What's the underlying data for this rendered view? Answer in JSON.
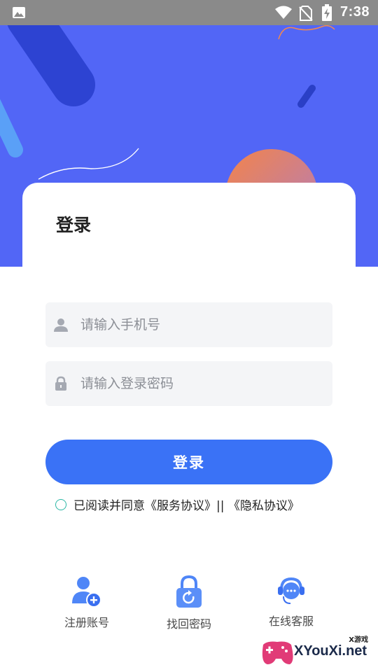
{
  "status_bar": {
    "time": "7:38",
    "icons": [
      "gallery-icon",
      "wifi-icon",
      "no-sim-icon",
      "battery-charging-icon"
    ]
  },
  "login": {
    "title": "登录",
    "phone_placeholder": "请输入手机号",
    "password_placeholder": "请输入登录密码",
    "submit_label": "登录",
    "agreement_text": "已阅读并同意《服务协议》|| 《隐私协议》"
  },
  "actions": [
    {
      "label": "注册账号",
      "icon": "add-user-icon"
    },
    {
      "label": "找回密码",
      "icon": "lock-refresh-icon"
    },
    {
      "label": "在线客服",
      "icon": "customer-service-icon"
    }
  ],
  "watermark": {
    "small_text": "X游戏",
    "brand_text": "XYouXi.net"
  },
  "colors": {
    "header_blue": "#4f65f6",
    "button_blue": "#3a72f6",
    "radio_teal": "#2bb7a5"
  }
}
